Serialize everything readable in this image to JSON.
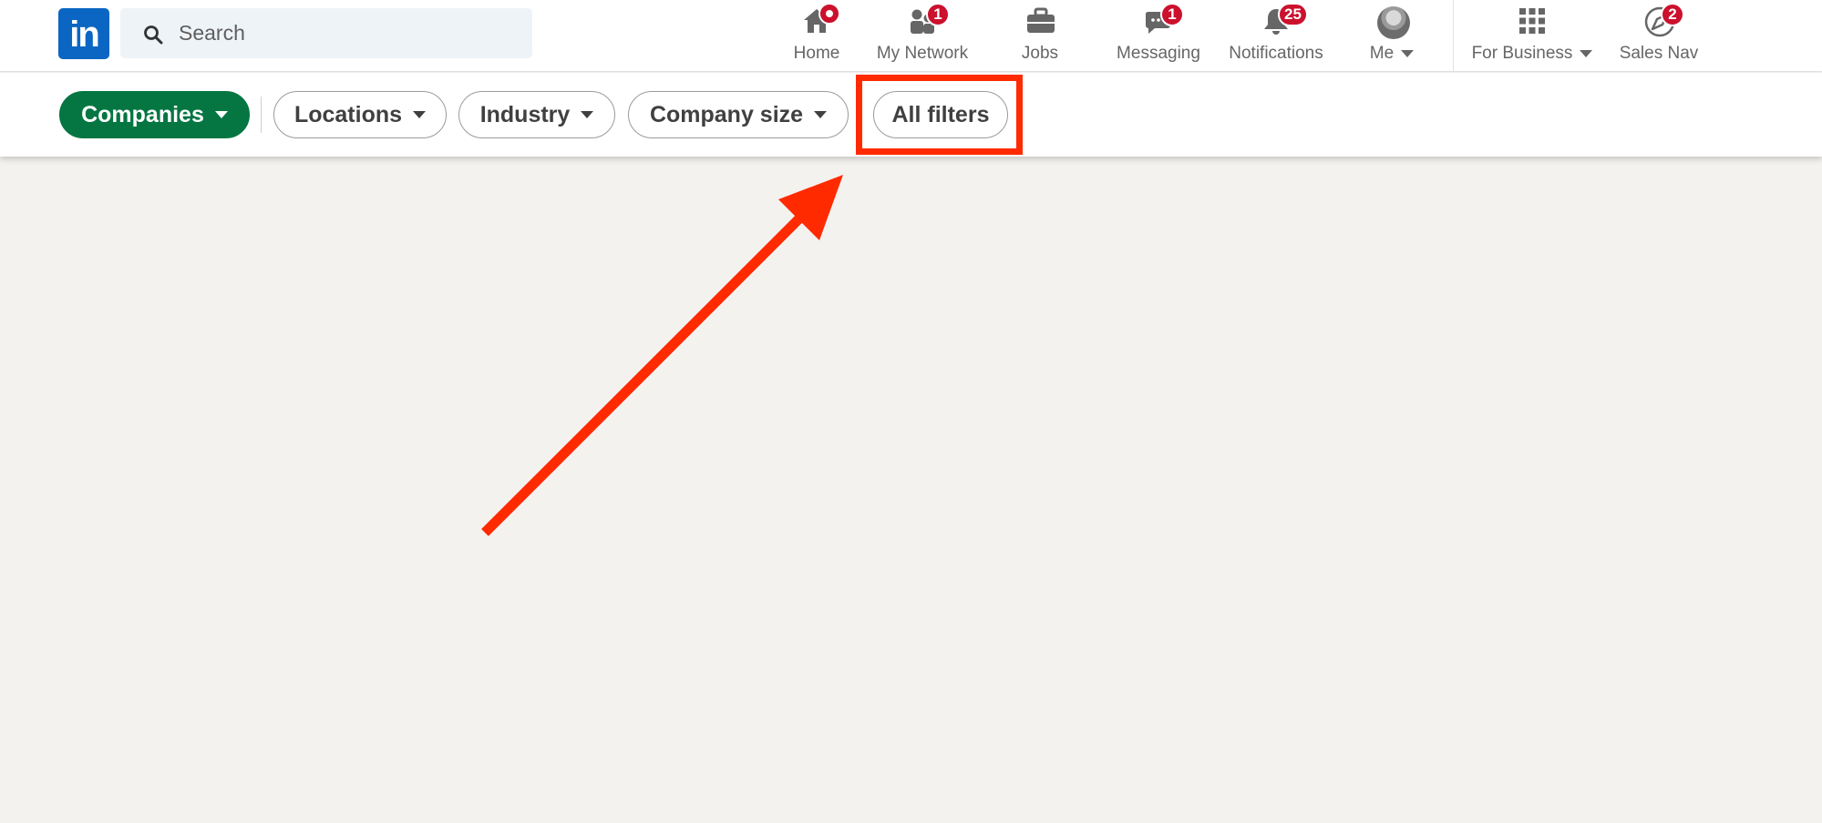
{
  "nav": {
    "logo_text": "in",
    "search_placeholder": "Search",
    "items": [
      {
        "label": "Home",
        "icon": "home-icon",
        "badge": ""
      },
      {
        "label": "My Network",
        "icon": "network-icon",
        "badge": "1"
      },
      {
        "label": "Jobs",
        "icon": "briefcase-icon",
        "badge": ""
      },
      {
        "label": "Messaging",
        "icon": "chat-icon",
        "badge": "1"
      },
      {
        "label": "Notifications",
        "icon": "bell-icon",
        "badge": "25"
      },
      {
        "label": "Me",
        "icon": "avatar",
        "badge": ""
      },
      {
        "label": "For Business",
        "icon": "grid-icon",
        "badge": ""
      },
      {
        "label": "Sales Nav",
        "icon": "compass-icon",
        "badge": "2"
      }
    ]
  },
  "filters": {
    "primary": "Companies",
    "items": [
      "Locations",
      "Industry",
      "Company size",
      "All filters"
    ]
  },
  "colors": {
    "brand": "#0a66c2",
    "primary_pill": "#057642",
    "badge": "#cb112d",
    "annotation": "#ff2a00"
  }
}
